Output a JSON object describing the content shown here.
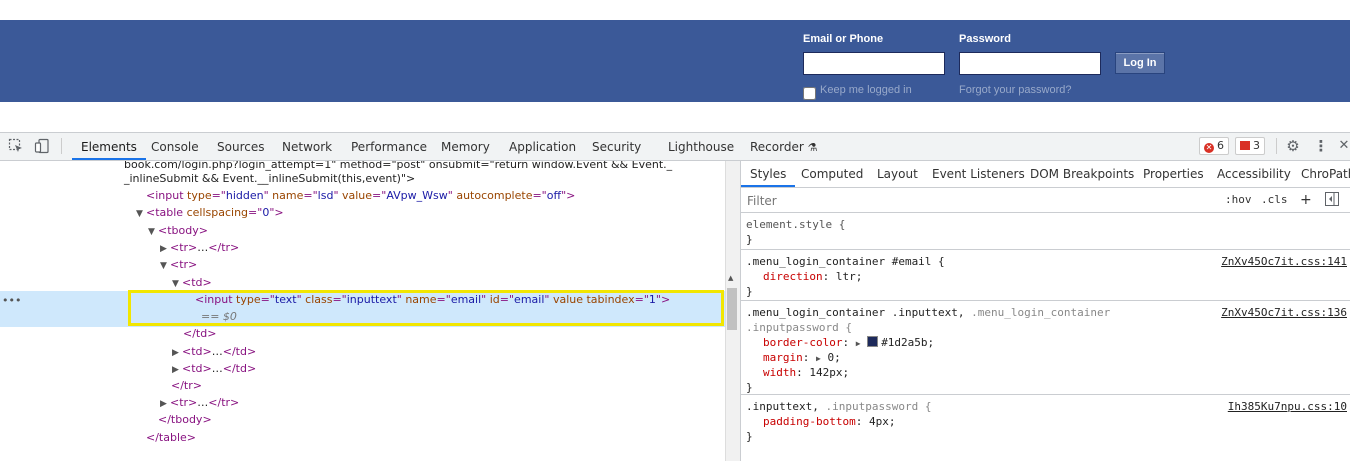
{
  "login": {
    "email_label": "Email or Phone",
    "password_label": "Password",
    "email_value": "",
    "password_value": "",
    "login_button": "Log In",
    "keep_logged_in": "Keep me logged in",
    "forgot_password": "Forgot your password?"
  },
  "devtools": {
    "tabs": [
      "Elements",
      "Console",
      "Sources",
      "Network",
      "Performance",
      "Memory",
      "Application",
      "Security",
      "Lighthouse",
      "Recorder"
    ],
    "active_tab": "Elements",
    "error_count": "6",
    "issue_count": "3",
    "dom": {
      "line0": "book.com/login.php?login_attempt=1\" method=\"post\" onsubmit=\"return window.Event && Event._",
      "line1": "_inlineSubmit && Event.__inlineSubmit(this,event)\">",
      "input_hidden_attr_type": "type",
      "input_hidden_type": "hidden",
      "input_hidden_attr_name": "name",
      "input_hidden_name": "lsd",
      "input_hidden_attr_value": "value",
      "input_hidden_value": "AVpw_Wsw",
      "input_hidden_attr_autocomplete": "autocomplete",
      "input_hidden_autocomplete": "off",
      "table_attr": "cellspacing",
      "table_cellspacing": "0",
      "selected_type": "text",
      "selected_class": "inputtext",
      "selected_name": "email",
      "selected_id": "email",
      "selected_tabindex": "1",
      "selected_marker": "== $0",
      "collapsed": "…"
    },
    "styles": {
      "sub_tabs": [
        "Styles",
        "Computed",
        "Layout",
        "Event Listeners",
        "DOM Breakpoints",
        "Properties",
        "Accessibility",
        "ChroPath"
      ],
      "filter_placeholder": "Filter",
      "hov": ":hov",
      "cls": ".cls",
      "rules": {
        "element_style": "element.style {",
        "r1_selector": ".menu_login_container #email {",
        "r1_source": "ZnXv45Oc7it.css:141",
        "r1_prop": "direction",
        "r1_value": "ltr;",
        "r2_selector_a": ".menu_login_container .inputtext,",
        "r2_selector_b": " .menu_login_container",
        "r2_selector_c": ".inputpassword {",
        "r2_source": "ZnXv45Oc7it.css:136",
        "r2_prop1": "border-color",
        "r2_value1": "#1d2a5b;",
        "r2_prop2": "margin",
        "r2_value2": "0;",
        "r2_prop3": "width",
        "r2_value3": "142px;",
        "r3_selector_a": ".inputtext,",
        "r3_selector_b": " .inputpassword {",
        "r3_source": "Ih385Ku7npu.css:10",
        "r3_prop": "padding-bottom",
        "r3_value": "4px;"
      }
    }
  },
  "colors": {
    "header_blue": "#3b5998",
    "highlight_yellow": "#f2e600",
    "selection_blue": "#cfe8fc",
    "border_color_swatch": "#1d2a5b"
  }
}
